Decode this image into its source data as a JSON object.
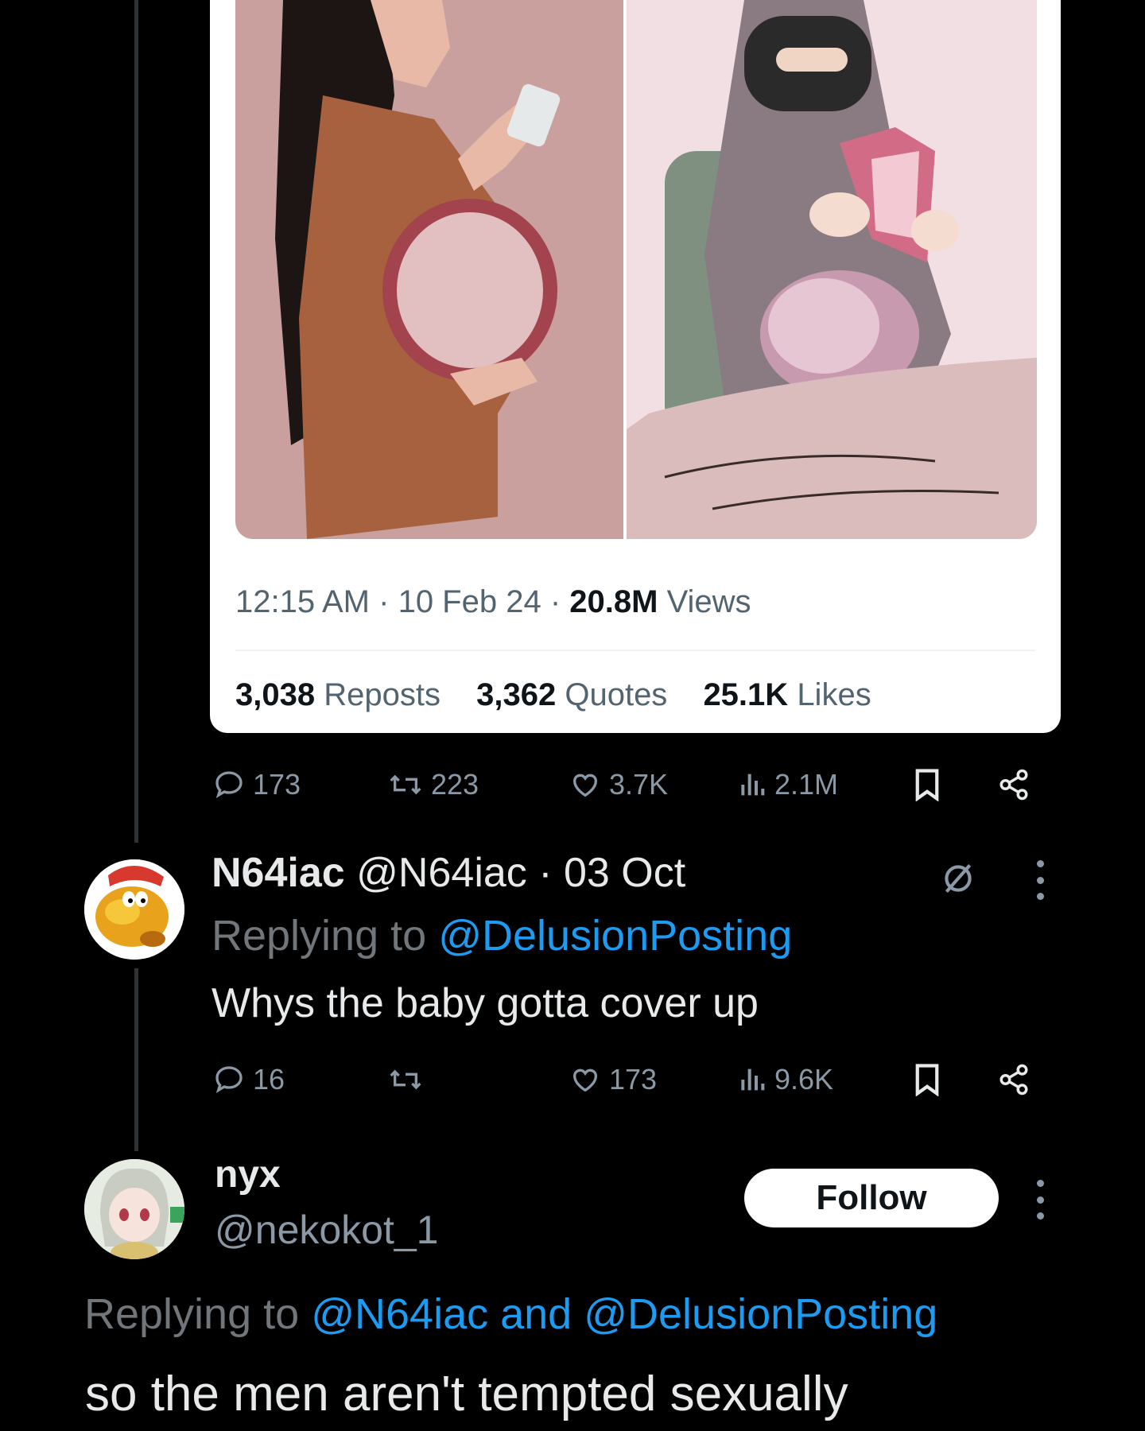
{
  "quoted_card": {
    "time": "12:15 AM",
    "date": "10 Feb 24",
    "views_count": "20.8M",
    "views_label": "Views",
    "reposts_count": "3,038",
    "reposts_label": "Reposts",
    "quotes_count": "3,362",
    "quotes_label": "Quotes",
    "likes_count": "25.1K",
    "likes_label": "Likes"
  },
  "main_actions": {
    "replies": "173",
    "reposts": "223",
    "likes": "3.7K",
    "views": "2.1M"
  },
  "reply1": {
    "name": "N64iac",
    "handle": "@N64iac",
    "date": "03 Oct",
    "replying_prefix": "Replying to",
    "replying_to": "@DelusionPosting",
    "text": "Whys the baby gotta cover up",
    "actions": {
      "replies": "16",
      "reposts": "",
      "likes": "173",
      "views": "9.6K"
    }
  },
  "reply2": {
    "name": "nyx",
    "handle": "@nekokot_1",
    "follow_label": "Follow",
    "replying_prefix": "Replying to",
    "replying_to": "@N64iac and @DelusionPosting",
    "text": "so the men aren't tempted sexually"
  },
  "colors": {
    "background": "#000000",
    "link": "#1d9bf0",
    "muted": "#71767b"
  }
}
